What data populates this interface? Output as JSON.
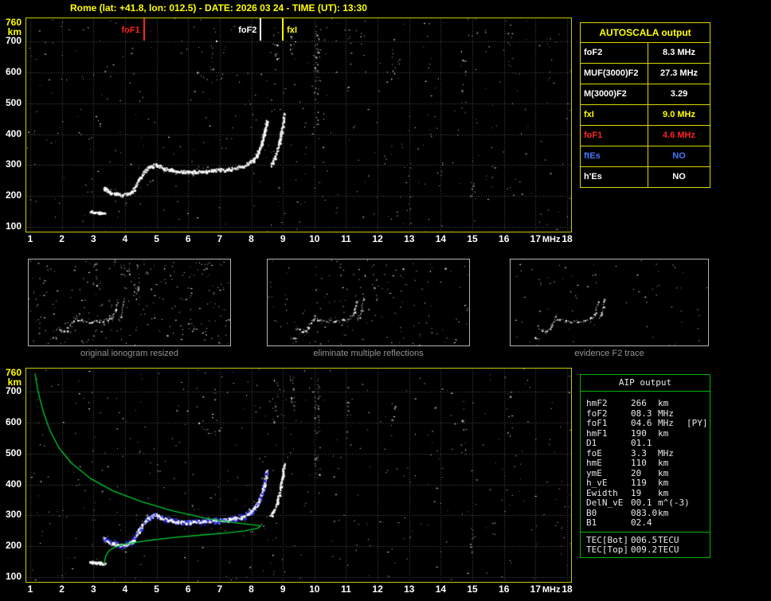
{
  "title": "Rome (lat: +41.8, lon: 012.5) - DATE: 2026 03 24 - TIME (UT): 13:30",
  "charts": {
    "x_ticks": [
      1,
      2,
      3,
      4,
      5,
      6,
      7,
      8,
      9,
      10,
      11,
      12,
      13,
      14,
      15,
      16,
      17,
      18
    ],
    "x_unit": "MHz",
    "y_ticks": [
      760,
      700,
      600,
      500,
      400,
      300,
      200,
      100
    ],
    "y_unit": "km"
  },
  "markers": [
    {
      "label": "foF1",
      "freq": 4.6,
      "color": "#ff2222",
      "label_side": "left"
    },
    {
      "label": "foF2",
      "freq": 8.3,
      "color": "#ffffff",
      "label_side": "left"
    },
    {
      "label": "fxI",
      "freq": 9.0,
      "color": "#ffff00",
      "label_side": "right"
    }
  ],
  "autoscala_panel": {
    "title": "AUTOSCALA output",
    "rows": [
      {
        "param": "foF2",
        "value": "8.3 MHz",
        "color": "#ffffff"
      },
      {
        "param": "MUF(3000)F2",
        "value": "27.3 MHz",
        "color": "#ffffff"
      },
      {
        "param": "M(3000)F2",
        "value": "3.29",
        "color": "#ffffff"
      },
      {
        "param": "fxI",
        "value": "9.0 MHz",
        "color": "#ffff00"
      },
      {
        "param": "foF1",
        "value": "4.6 MHz",
        "color": "#ff2222"
      },
      {
        "param": "ftEs",
        "value": "NO",
        "color": "#4477ff"
      },
      {
        "param": "h'Es",
        "value": "NO",
        "color": "#ffffff"
      }
    ]
  },
  "thumbnails": [
    {
      "caption": "original ionogram resized"
    },
    {
      "caption": "eliminate multiple reflections"
    },
    {
      "caption": "evidence F2 trace"
    }
  ],
  "aip_panel": {
    "title": "AIP output",
    "rows": [
      {
        "param": "hmF2",
        "value": "266",
        "unit": "km",
        "note": ""
      },
      {
        "param": "foF2",
        "value": "08.3",
        "unit": "MHz",
        "note": ""
      },
      {
        "param": "foF1",
        "value": "04.6",
        "unit": "MHz",
        "note": "[PY]"
      },
      {
        "param": "hmF1",
        "value": "190",
        "unit": "km",
        "note": ""
      },
      {
        "param": "D1",
        "value": "01.1",
        "unit": "",
        "note": ""
      },
      {
        "param": "foE",
        "value": "3.3",
        "unit": "MHz",
        "note": ""
      },
      {
        "param": "hmE",
        "value": "110",
        "unit": "km",
        "note": ""
      },
      {
        "param": "ymE",
        "value": "20",
        "unit": "km",
        "note": ""
      },
      {
        "param": "h_vE",
        "value": "119",
        "unit": "km",
        "note": ""
      },
      {
        "param": "Ewidth",
        "value": "19",
        "unit": "km",
        "note": ""
      },
      {
        "param": "DelN_vE",
        "value": "00.1",
        "unit": "m^(-3)",
        "note": ""
      },
      {
        "param": "B0",
        "value": "083.0",
        "unit": "km",
        "note": ""
      },
      {
        "param": "B1",
        "value": "02.4",
        "unit": "",
        "note": ""
      }
    ],
    "tec_rows": [
      {
        "param": "TEC[Bot]",
        "value": "006.5",
        "unit": "TECU"
      },
      {
        "param": "TEC[Top]",
        "value": "009.2",
        "unit": "TECU"
      }
    ]
  },
  "chart_data": {
    "type": "scatter",
    "title": "Ionogram, Rome, 2026-03-24 13:30 UT",
    "xlabel": "MHz",
    "ylabel": "km",
    "x_range": [
      1,
      18
    ],
    "y_range": [
      100,
      760
    ],
    "grid": true,
    "traces": {
      "f_trace": [
        [
          3.3,
          228
        ],
        [
          3.55,
          212
        ],
        [
          3.9,
          203
        ],
        [
          4.2,
          214
        ],
        [
          4.45,
          258
        ],
        [
          4.7,
          292
        ],
        [
          4.95,
          303
        ],
        [
          5.2,
          292
        ],
        [
          5.5,
          283
        ],
        [
          6.0,
          279
        ],
        [
          6.6,
          283
        ],
        [
          7.25,
          288
        ],
        [
          7.75,
          298
        ],
        [
          8.05,
          318
        ],
        [
          8.25,
          352
        ],
        [
          8.38,
          398
        ],
        [
          8.48,
          448
        ]
      ],
      "x_trace": [
        [
          8.6,
          300
        ],
        [
          8.72,
          322
        ],
        [
          8.82,
          352
        ],
        [
          8.9,
          390
        ],
        [
          8.97,
          430
        ],
        [
          9.03,
          472
        ]
      ],
      "e_trace": [
        [
          2.88,
          152
        ],
        [
          3.05,
          149
        ],
        [
          3.2,
          147
        ],
        [
          3.38,
          144
        ]
      ],
      "second_hop": [
        [
          6.3,
          600
        ],
        [
          6.5,
          582
        ],
        [
          6.75,
          572
        ],
        [
          7.0,
          576
        ],
        [
          7.15,
          590
        ]
      ]
    },
    "profile": [
      [
        1.15,
        760
      ],
      [
        1.25,
        700
      ],
      [
        1.4,
        640
      ],
      [
        1.6,
        580
      ],
      [
        1.9,
        520
      ],
      [
        2.3,
        470
      ],
      [
        2.9,
        420
      ],
      [
        3.6,
        380
      ],
      [
        4.5,
        345
      ],
      [
        5.5,
        315
      ],
      [
        6.5,
        292
      ],
      [
        7.4,
        277
      ],
      [
        8.05,
        269
      ],
      [
        8.3,
        266
      ],
      [
        8.2,
        258
      ],
      [
        7.8,
        250
      ],
      [
        7.2,
        243
      ],
      [
        6.4,
        236
      ],
      [
        5.5,
        228
      ],
      [
        4.7,
        218
      ],
      [
        4.0,
        207
      ],
      [
        3.65,
        196
      ],
      [
        3.48,
        184
      ],
      [
        3.4,
        170
      ],
      [
        3.36,
        155
      ],
      [
        3.33,
        140
      ]
    ],
    "noise_columns": [
      {
        "f": 10.08,
        "km0": 430,
        "km1": 755,
        "n": 46
      },
      {
        "f": 9.3,
        "km0": 640,
        "km1": 755,
        "n": 16
      },
      {
        "f": 8.75,
        "km0": 600,
        "km1": 750,
        "n": 12
      },
      {
        "f": 11.1,
        "km0": 520,
        "km1": 740,
        "n": 10
      },
      {
        "f": 12.5,
        "km0": 580,
        "km1": 720,
        "n": 8
      },
      {
        "f": 14.7,
        "km0": 470,
        "km1": 690,
        "n": 12
      },
      {
        "f": 16.2,
        "km0": 560,
        "km1": 740,
        "n": 8
      },
      {
        "f": 6.8,
        "km0": 600,
        "km1": 750,
        "n": 7
      },
      {
        "f": 15.0,
        "km0": 180,
        "km1": 260,
        "n": 10
      }
    ],
    "scaled_values": {
      "foF2_MHz": 8.3,
      "MUF3000F2_MHz": 27.3,
      "M3000F2": 3.29,
      "fxI_MHz": 9.0,
      "foF1_MHz": 4.6,
      "ftEs": "NO",
      "hEs": "NO",
      "hmF2_km": 266,
      "hmF1_km": 190,
      "D1": 1.1,
      "foE_MHz": 3.3,
      "hmE_km": 110,
      "ymE_km": 20,
      "h_vE_km": 119,
      "Ewidth_km": 19,
      "DelN_vE": 0.1,
      "B0_km": 83.0,
      "B1": 2.4,
      "TEC_bot_TECU": 6.5,
      "TEC_top_TECU": 9.2
    }
  }
}
